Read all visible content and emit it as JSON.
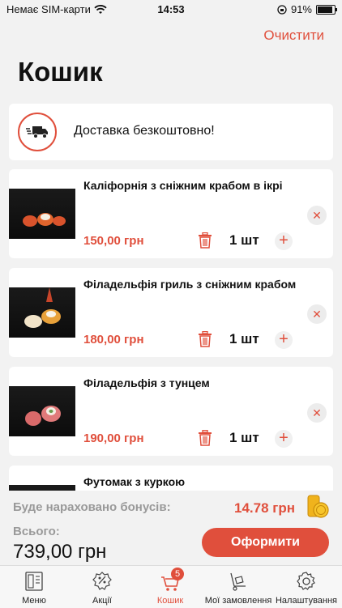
{
  "status_bar": {
    "carrier": "Немає SIM-карти",
    "time": "14:53",
    "battery": "91%"
  },
  "header": {
    "clear_label": "Очистити",
    "title": "Кошик"
  },
  "delivery": {
    "text": "Доставка безкоштовно!"
  },
  "items": [
    {
      "name": "Каліфорнія з сніжним крабом в ікрі",
      "price": "150,00 грн",
      "qty": "1 шт"
    },
    {
      "name": "Філадельфія гриль з сніжним крабом",
      "price": "180,00 грн",
      "qty": "1 шт"
    },
    {
      "name": "Філадельфія з тунцем",
      "price": "190,00 грн",
      "qty": "1 шт"
    },
    {
      "name": "Футомак з куркою",
      "price": "",
      "qty": ""
    }
  ],
  "summary": {
    "bonus_label": "Буде нараховано бонусів:",
    "bonus_value": "14.78 грн",
    "total_label": "Всього:",
    "total_value": "739,00 грн",
    "checkout_label": "Оформити"
  },
  "tabbar": {
    "tabs": [
      {
        "label": "Меню",
        "icon": "menu-book-icon"
      },
      {
        "label": "Акції",
        "icon": "percent-badge-icon"
      },
      {
        "label": "Кошик",
        "icon": "cart-icon",
        "badge": "5"
      },
      {
        "label": "Мої замовлення",
        "icon": "hand-truck-icon"
      },
      {
        "label": "Налаштування",
        "icon": "gear-icon"
      }
    ]
  },
  "colors": {
    "accent": "#e04f3c",
    "background": "#f2f2f2"
  }
}
